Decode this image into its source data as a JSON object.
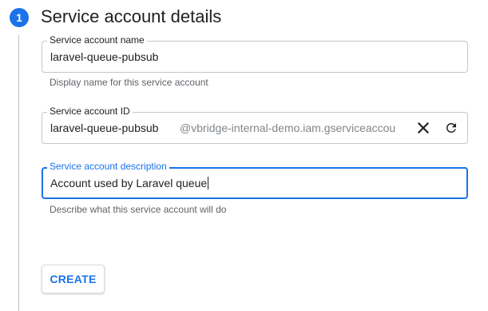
{
  "step": {
    "number": "1",
    "title": "Service account details"
  },
  "fields": {
    "name": {
      "label": "Service account name",
      "value": "laravel-queue-pubsub",
      "helper": "Display name for this service account"
    },
    "id": {
      "label": "Service account ID",
      "value": "laravel-queue-pubsub",
      "suffix": "@vbridge-internal-demo.iam.gserviceaccou",
      "clear_icon": "close-icon",
      "regenerate_icon": "refresh-icon"
    },
    "description": {
      "label": "Service account description",
      "value": "Account used by Laravel queue",
      "helper": "Describe what this service account will do",
      "focused": true
    }
  },
  "actions": {
    "create_label": "CREATE"
  },
  "colors": {
    "accent": "#1a73e8",
    "border": "#c4c7cc",
    "helper_text": "#5f6368",
    "suffix_text": "#80868b"
  }
}
